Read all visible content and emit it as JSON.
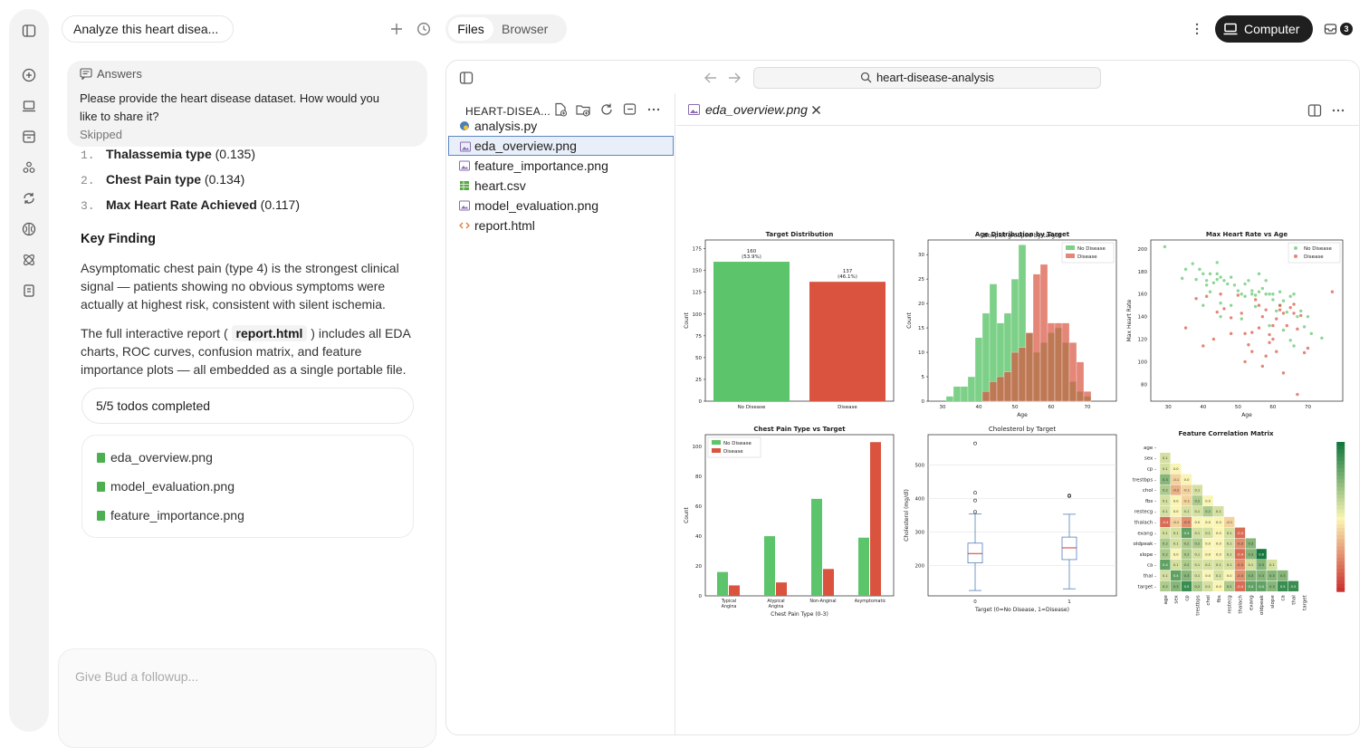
{
  "chat": {
    "title": "Analyze this heart disea...",
    "answers": {
      "header": "Answers",
      "question": "Please provide the heart disease dataset. How would you like to share it?",
      "status": "Skipped"
    },
    "list": [
      {
        "num": "1.",
        "name": "Thalassemia type",
        "value": "(0.135)"
      },
      {
        "num": "2.",
        "name": "Chest Pain type",
        "value": "(0.134)"
      },
      {
        "num": "3.",
        "name": "Max Heart Rate Achieved",
        "value": "(0.117)"
      }
    ],
    "key_finding": "Key Finding",
    "para1": "Asymptomatic chest pain (type 4) is the strongest clinical signal — patients showing no obvious symptoms were actually at highest risk, consistent with silent ischemia.",
    "para2_before": "The full interactive report (",
    "para2_code": "report.html",
    "para2_after": ") includes all EDA charts, ROC curves, confusion matrix, and feature importance plots — all embedded as a single portable file.",
    "todos": "5/5 todos completed",
    "files": [
      "eda_overview.png",
      "model_evaluation.png",
      "feature_importance.png"
    ],
    "composer_placeholder": "Give Bud a followup..."
  },
  "topbar": {
    "tab_files": "Files",
    "tab_browser": "Browser",
    "computer": "Computer",
    "inbox_count": "3"
  },
  "panel": {
    "address": "heart-disease-analysis",
    "sidebar_title": "HEART-DISEA...",
    "tree": [
      {
        "name": "analysis.py",
        "icon": "python-icon",
        "color": "#4a7fb5"
      },
      {
        "name": "eda_overview.png",
        "icon": "image-icon",
        "color": "#8a6bb0"
      },
      {
        "name": "feature_importance.png",
        "icon": "image-icon",
        "color": "#8a6bb0"
      },
      {
        "name": "heart.csv",
        "icon": "csv-icon",
        "color": "#5aa84a"
      },
      {
        "name": "model_evaluation.png",
        "icon": "image-icon",
        "color": "#8a6bb0"
      },
      {
        "name": "report.html",
        "icon": "code-icon",
        "color": "#e07b39"
      }
    ],
    "selected_index": 1,
    "editor_tab": "eda_overview.png"
  },
  "chart_data": [
    {
      "type": "bar",
      "title": "Target Distribution",
      "categories": [
        "No Disease",
        "Disease"
      ],
      "values": [
        160,
        137
      ],
      "data_labels": [
        "160\n(53.9%)",
        "137\n(46.1%)"
      ],
      "ylabel": "Count",
      "yticks": [
        0,
        25,
        50,
        75,
        100,
        125,
        150,
        175
      ],
      "ylim": [
        0,
        185
      ],
      "colors": [
        "#5cc46a",
        "#d9533e"
      ]
    },
    {
      "type": "bar",
      "subtitle": "Age Distribution by Target",
      "xlabel": "Age",
      "ylabel": "Count",
      "xticks": [
        30,
        40,
        50,
        60,
        70
      ],
      "yticks": [
        0,
        5,
        10,
        15,
        20,
        25,
        30
      ],
      "bins": [
        29,
        31,
        33,
        35,
        37,
        39,
        41,
        43,
        45,
        47,
        49,
        51,
        53,
        55,
        57,
        59,
        61,
        63,
        65,
        67,
        69,
        71,
        73,
        75,
        77
      ],
      "series": [
        {
          "name": "No Disease",
          "values": [
            0,
            1,
            3,
            3,
            5,
            13,
            18,
            24,
            16,
            18,
            25,
            32,
            14,
            10,
            12,
            14,
            15,
            12,
            4,
            2,
            1
          ]
        },
        {
          "name": "Disease",
          "values": [
            0,
            0,
            0,
            0,
            0,
            0,
            2,
            4,
            5,
            6,
            10,
            11,
            14,
            26,
            28,
            16,
            16,
            16,
            12,
            8,
            2
          ]
        }
      ],
      "legend": "upper-right"
    },
    {
      "type": "scatter",
      "title": "Max Heart Rate vs Age",
      "xlabel": "Age",
      "ylabel": "Max Heart Rate",
      "xticks": [
        30,
        40,
        50,
        60,
        70
      ],
      "yticks": [
        80,
        100,
        120,
        140,
        160,
        180,
        200
      ],
      "series": [
        {
          "name": "No Disease",
          "points": [
            [
              29,
              202
            ],
            [
              34,
              174
            ],
            [
              35,
              182
            ],
            [
              37,
              187
            ],
            [
              38,
              173
            ],
            [
              39,
              182
            ],
            [
              40,
              178
            ],
            [
              41,
              172
            ],
            [
              41,
              168
            ],
            [
              42,
              162
            ],
            [
              43,
              170
            ],
            [
              44,
              178
            ],
            [
              44,
              173
            ],
            [
              45,
              175
            ],
            [
              45,
              152
            ],
            [
              46,
              172
            ],
            [
              47,
              169
            ],
            [
              48,
              175
            ],
            [
              49,
              168
            ],
            [
              50,
              163
            ],
            [
              51,
              160
            ],
            [
              52,
              169
            ],
            [
              53,
              172
            ],
            [
              54,
              160
            ],
            [
              54,
              163
            ],
            [
              55,
              159
            ],
            [
              56,
              162
            ],
            [
              57,
              165
            ],
            [
              58,
              160
            ],
            [
              59,
              160
            ],
            [
              60,
              155
            ],
            [
              61,
              145
            ],
            [
              62,
              150
            ],
            [
              63,
              154
            ],
            [
              64,
              144
            ],
            [
              65,
              158
            ],
            [
              66,
              160
            ],
            [
              67,
              140
            ],
            [
              68,
              145
            ],
            [
              69,
              131
            ],
            [
              70,
              140
            ],
            [
              71,
              125
            ],
            [
              74,
              121
            ],
            [
              44,
              188
            ],
            [
              42,
              178
            ],
            [
              52,
              158
            ],
            [
              56,
              178
            ],
            [
              58,
              172
            ],
            [
              62,
              162
            ],
            [
              45,
              140
            ],
            [
              48,
              150
            ],
            [
              51,
              138
            ],
            [
              59,
              132
            ],
            [
              63,
              128
            ],
            [
              66,
              114
            ],
            [
              40,
              150
            ],
            [
              55,
              149
            ],
            [
              60,
              160
            ],
            [
              65,
              119
            ]
          ]
        },
        {
          "name": "Disease",
          "points": [
            [
              35,
              130
            ],
            [
              38,
              156
            ],
            [
              40,
              114
            ],
            [
              41,
              158
            ],
            [
              43,
              120
            ],
            [
              44,
              144
            ],
            [
              46,
              147
            ],
            [
              48,
              139
            ],
            [
              50,
              159
            ],
            [
              51,
              143
            ],
            [
              52,
              125
            ],
            [
              53,
              115
            ],
            [
              54,
              126
            ],
            [
              55,
              155
            ],
            [
              56,
              130
            ],
            [
              57,
              140
            ],
            [
              58,
              146
            ],
            [
              59,
              124
            ],
            [
              60,
              132
            ],
            [
              61,
              138
            ],
            [
              62,
              146
            ],
            [
              63,
              143
            ],
            [
              64,
              132
            ],
            [
              65,
              148
            ],
            [
              66,
              151
            ],
            [
              67,
              129
            ],
            [
              68,
              141
            ],
            [
              69,
              108
            ],
            [
              70,
              112
            ],
            [
              77,
              162
            ],
            [
              57,
              96
            ],
            [
              52,
              100
            ],
            [
              58,
              105
            ],
            [
              61,
              109
            ],
            [
              63,
              90
            ],
            [
              60,
              120
            ],
            [
              54,
              109
            ],
            [
              56,
              150
            ],
            [
              59,
              117
            ],
            [
              45,
              160
            ],
            [
              48,
              125
            ],
            [
              62,
              150
            ],
            [
              66,
              143
            ],
            [
              67,
              71
            ]
          ]
        }
      ],
      "legend": "upper-right"
    },
    {
      "type": "bar",
      "title": "Chest Pain Type vs Target",
      "xlabel": "Chest Pain Type (0-3)",
      "ylabel": "Count",
      "categories": [
        "Typical\nAngina",
        "Atypical\nAngina",
        "Non-Anginal",
        "Asymptomatic"
      ],
      "yticks": [
        0,
        20,
        40,
        60,
        80,
        100
      ],
      "series": [
        {
          "name": "No Disease",
          "values": [
            16,
            40,
            65,
            39
          ]
        },
        {
          "name": "Disease",
          "values": [
            7,
            9,
            18,
            103
          ]
        }
      ],
      "legend": "upper-left"
    },
    {
      "type": "box",
      "suptitle": "Boxplot grouped by target",
      "title": "Cholesterol by Target",
      "xlabel": "Target (0=No Disease, 1=Disease)",
      "ylabel": "Cholesterol (mg/dl)",
      "categories": [
        "0",
        "1"
      ],
      "yticks": [
        200,
        300,
        400,
        500
      ],
      "boxes": [
        {
          "min": 126,
          "q1": 208,
          "median": 236,
          "q3": 267,
          "max": 354,
          "outliers": [
            360,
            394,
            417,
            564
          ]
        },
        {
          "min": 131,
          "q1": 218,
          "median": 253,
          "q3": 285,
          "max": 353,
          "outliers": [
            407,
            409
          ]
        }
      ]
    },
    {
      "type": "heatmap",
      "title": "Feature Correlation Matrix",
      "labels": [
        "age",
        "sex",
        "cp",
        "trestbps",
        "chol",
        "fbs",
        "restecg",
        "thalach",
        "exang",
        "oldpeak",
        "slope",
        "ca",
        "thal",
        "target"
      ],
      "colorbar_ticks": [
        0.4,
        0.2,
        0.0,
        -0.2,
        -0.4
      ],
      "values": [
        [],
        [
          0.1
        ],
        [
          0.1,
          0.0
        ],
        [
          0.3,
          -0.1,
          -0.0
        ],
        [
          0.2,
          -0.2,
          -0.1,
          0.1
        ],
        [
          0.1,
          0.0,
          -0.1,
          0.2,
          0.0
        ],
        [
          0.1,
          0.0,
          0.1,
          0.1,
          0.2,
          0.1
        ],
        [
          -0.4,
          -0.1,
          -0.3,
          -0.0,
          -0.0,
          -0.0,
          -0.1
        ],
        [
          0.1,
          0.1,
          0.4,
          0.1,
          0.1,
          0.0,
          0.1,
          -0.4
        ],
        [
          0.2,
          0.1,
          0.2,
          0.2,
          0.0,
          0.0,
          0.1,
          -0.3,
          0.3
        ],
        [
          0.2,
          0.0,
          0.2,
          0.1,
          -0.0,
          0.0,
          0.1,
          -0.4,
          0.3,
          0.6
        ],
        [
          0.4,
          0.1,
          0.2,
          0.1,
          0.1,
          0.1,
          0.1,
          -0.3,
          0.1,
          0.3,
          0.1
        ],
        [
          0.1,
          0.4,
          0.3,
          0.1,
          0.0,
          0.1,
          0.0,
          -0.3,
          0.3,
          0.3,
          0.3,
          0.3
        ],
        [
          0.2,
          0.3,
          0.5,
          0.2,
          0.1,
          0.0,
          0.2,
          -0.4,
          0.4,
          0.4,
          0.3,
          0.5,
          0.5
        ]
      ]
    }
  ]
}
